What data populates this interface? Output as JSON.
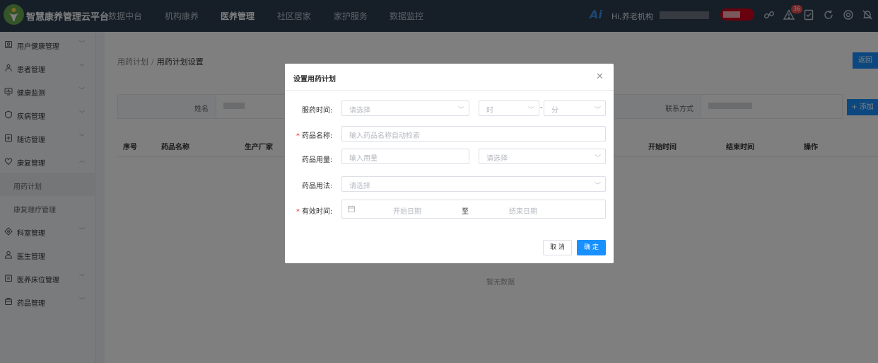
{
  "topbar": {
    "brand": "智慧康养管理云平台",
    "nav": [
      "数据中台",
      "机构康养",
      "医养管理",
      "社区居家",
      "家护服务",
      "数据监控"
    ],
    "active_nav": "医养管理",
    "ai_label": "Ai",
    "greeting": "Hi,养老机构",
    "notification_count": "36",
    "icons": [
      "link-icon",
      "alert-icon",
      "document-icon",
      "refresh-icon",
      "power-icon",
      "bell-off-icon"
    ],
    "colors": {
      "bar": "#2d3e50",
      "badge": "#ee4d4d",
      "accent": "#1890ff"
    }
  },
  "sidebar": {
    "items": [
      {
        "label": "用户健康管理",
        "icon": "id-card-icon",
        "expandable": true
      },
      {
        "label": "患者管理",
        "icon": "patient-icon",
        "expandable": true
      },
      {
        "label": "健康监测",
        "icon": "monitor-icon",
        "expandable": true
      },
      {
        "label": "疾病管理",
        "icon": "shield-icon",
        "expandable": true
      },
      {
        "label": "随访管理",
        "icon": "plus-square-icon",
        "expandable": true
      },
      {
        "label": "康复管理",
        "icon": "heart-icon",
        "expandable": true,
        "expanded": true
      },
      {
        "label": "科室管理",
        "icon": "diamond-icon",
        "expandable": true
      },
      {
        "label": "医生管理",
        "icon": "doctor-icon",
        "expandable": false
      },
      {
        "label": "医养床位管理",
        "icon": "bed-icon",
        "expandable": true
      },
      {
        "label": "药品管理",
        "icon": "medicine-icon",
        "expandable": true
      }
    ],
    "sub_items": [
      "用药计划",
      "康复理疗管理"
    ],
    "active_sub": "用药计划"
  },
  "page": {
    "breadcrumb": [
      "用药计划",
      "用药计划设置"
    ],
    "back_label": "返回",
    "add_label": "+ 添加",
    "info": {
      "name_label": "姓名",
      "contact_label": "联系方式"
    },
    "table_headers": [
      "序号",
      "药品名称",
      "生产厂家",
      "开始时间",
      "结束时间",
      "操作"
    ],
    "empty_text": "暂无数据"
  },
  "modal": {
    "title": "设置用药计划",
    "close_icon": "close-icon",
    "fields": {
      "time": {
        "label": "服药时间:",
        "date_placeholder": "请选择",
        "hour_placeholder": "时",
        "minute_placeholder": "分",
        "separator": "-"
      },
      "drug_name": {
        "label": "药品名称:",
        "required": true,
        "placeholder": "输入药品名称自动检索"
      },
      "dosage": {
        "label": "药品用量:",
        "placeholder": "输入用量",
        "unit_placeholder": "请选择"
      },
      "usage": {
        "label": "药品用法:",
        "placeholder": "请选择"
      },
      "valid_period": {
        "label": "有效时间:",
        "required": true,
        "start_placeholder": "开始日期",
        "to": "至",
        "end_placeholder": "结束日期"
      }
    },
    "cancel_label": "取 消",
    "confirm_label": "确 定"
  }
}
